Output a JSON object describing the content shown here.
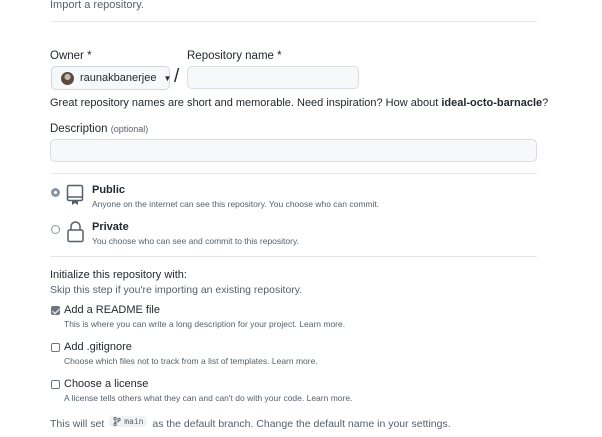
{
  "header": {
    "import_link": "Import a repository."
  },
  "owner": {
    "label": "Owner",
    "required_mark": "*",
    "selected": "raunakbanerjee",
    "separator": "/"
  },
  "repo_name": {
    "label": "Repository name",
    "required_mark": "*",
    "value": ""
  },
  "name_hint": {
    "text": "Great repository names are short and memorable. Need inspiration? How about ",
    "suggestion": "ideal-octo-barnacle",
    "suffix": "?"
  },
  "description": {
    "label": "Description",
    "optional": "(optional)",
    "value": ""
  },
  "visibility": {
    "public": {
      "title": "Public",
      "subtitle": "Anyone on the internet can see this repository. You choose who can commit.",
      "selected": true
    },
    "private": {
      "title": "Private",
      "subtitle": "You choose who can see and commit to this repository.",
      "selected": false
    }
  },
  "initialize": {
    "heading": "Initialize this repository with:",
    "skip_note": "Skip this step if you're importing an existing repository.",
    "options": [
      {
        "title": "Add a README file",
        "subtitle": "This is where you can write a long description for your project. Learn more.",
        "checked": true
      },
      {
        "title": "Add .gitignore",
        "subtitle": "Choose which files not to track from a list of templates. Learn more.",
        "checked": false
      },
      {
        "title": "Choose a license",
        "subtitle": "A license tells others what they can and can't do with your code. Learn more.",
        "checked": false
      }
    ]
  },
  "branch_note": {
    "prefix": "This will set",
    "branch": "main",
    "suffix": "as the default branch. Change the default name in your settings."
  },
  "colors": {
    "text": "#24292f",
    "muted": "#57606a",
    "border": "#d0d7de",
    "input_bg": "#f6f8fa"
  }
}
